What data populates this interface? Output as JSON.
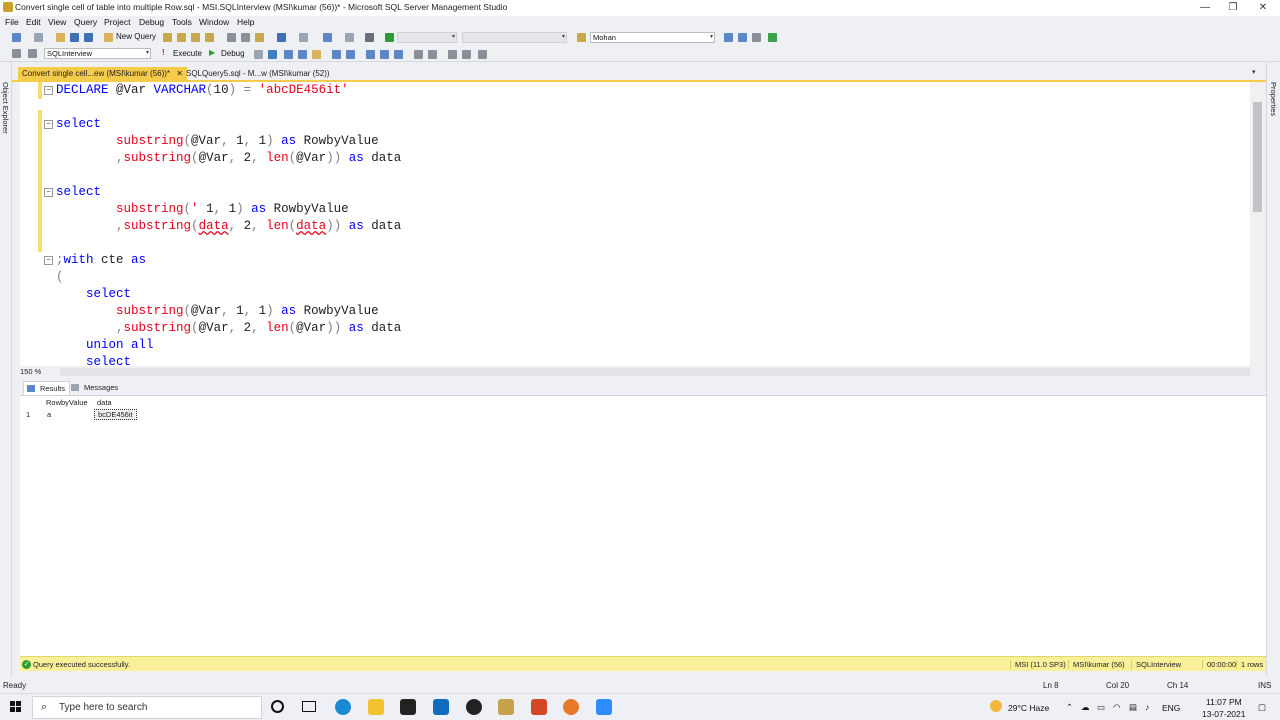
{
  "window": {
    "title": "Convert single cell of table into multiple Row.sql - MSI.SQLInterview (MSI\\kumar (56))* - Microsoft SQL Server Management Studio",
    "min": "—",
    "max": "❐",
    "close": "✕"
  },
  "menu": [
    "File",
    "Edit",
    "View",
    "Query",
    "Project",
    "Debug",
    "Tools",
    "Window",
    "Help"
  ],
  "toolbar": {
    "new_query": "New Query",
    "search_combo": "Mohan",
    "database_combo": "SQLInterview",
    "execute": "Execute",
    "debug": "Debug"
  },
  "side_panels": {
    "left": "Object Explorer",
    "right": "Properties"
  },
  "tabs": [
    {
      "label": "Convert single cell...ew (MSI\\kumar (56))*",
      "close": "✕",
      "active": true
    },
    {
      "label": "SQLQuery5.sql - M...w (MSI\\kumar (52))",
      "active": false
    }
  ],
  "code_lines": [
    [
      [
        "kw",
        "DECLARE"
      ],
      [
        "cm",
        " @Var "
      ],
      [
        "kw",
        "VARCHAR"
      ],
      [
        "op",
        "("
      ],
      [
        "cm",
        "10"
      ],
      [
        "op",
        ")"
      ],
      [
        "cm",
        " "
      ],
      [
        "op",
        "="
      ],
      [
        "cm",
        " "
      ],
      [
        "str",
        "'abcDE456it'"
      ]
    ],
    [],
    [
      [
        "kw",
        "select"
      ]
    ],
    [
      [
        "cm",
        "        "
      ],
      [
        "fn",
        "substring"
      ],
      [
        "op",
        "("
      ],
      [
        "cm",
        "@Var"
      ],
      [
        "op",
        ","
      ],
      [
        "cm",
        " 1"
      ],
      [
        "op",
        ","
      ],
      [
        "cm",
        " 1"
      ],
      [
        "op",
        ")"
      ],
      [
        "cm",
        " "
      ],
      [
        "kw",
        "as"
      ],
      [
        "cm",
        " RowbyValue"
      ]
    ],
    [
      [
        "cm",
        "        "
      ],
      [
        "op",
        ","
      ],
      [
        "fn",
        "substring"
      ],
      [
        "op",
        "("
      ],
      [
        "cm",
        "@Var"
      ],
      [
        "op",
        ","
      ],
      [
        "cm",
        " 2"
      ],
      [
        "op",
        ","
      ],
      [
        "cm",
        " "
      ],
      [
        "fn",
        "len"
      ],
      [
        "op",
        "("
      ],
      [
        "cm",
        "@Var"
      ],
      [
        "op",
        "))"
      ],
      [
        "cm",
        " "
      ],
      [
        "kw",
        "as"
      ],
      [
        "cm",
        " data"
      ]
    ],
    [],
    [
      [
        "kw",
        "select"
      ]
    ],
    [
      [
        "cm",
        "        "
      ],
      [
        "fn",
        "substring"
      ],
      [
        "op",
        "("
      ],
      [
        "str",
        "'"
      ],
      [
        "cm",
        " 1"
      ],
      [
        "op",
        ","
      ],
      [
        "cm",
        " 1"
      ],
      [
        "op",
        ")"
      ],
      [
        "cm",
        " "
      ],
      [
        "kw",
        "as"
      ],
      [
        "cm",
        " RowbyValue"
      ]
    ],
    [
      [
        "cm",
        "        "
      ],
      [
        "op",
        ","
      ],
      [
        "fn",
        "substring"
      ],
      [
        "op",
        "("
      ],
      [
        "sq",
        "data"
      ],
      [
        "op",
        ","
      ],
      [
        "cm",
        " 2"
      ],
      [
        "op",
        ","
      ],
      [
        "cm",
        " "
      ],
      [
        "fn",
        "len"
      ],
      [
        "op",
        "("
      ],
      [
        "sq",
        "data"
      ],
      [
        "op",
        "))"
      ],
      [
        "cm",
        " "
      ],
      [
        "kw",
        "as"
      ],
      [
        "cm",
        " data"
      ]
    ],
    [],
    [
      [
        "op",
        ";"
      ],
      [
        "kw",
        "with"
      ],
      [
        "cm",
        " cte "
      ],
      [
        "kw",
        "as"
      ]
    ],
    [
      [
        "op",
        "("
      ]
    ],
    [
      [
        "cm",
        "    "
      ],
      [
        "kw",
        "select"
      ]
    ],
    [
      [
        "cm",
        "        "
      ],
      [
        "fn",
        "substring"
      ],
      [
        "op",
        "("
      ],
      [
        "cm",
        "@Var"
      ],
      [
        "op",
        ","
      ],
      [
        "cm",
        " 1"
      ],
      [
        "op",
        ","
      ],
      [
        "cm",
        " 1"
      ],
      [
        "op",
        ")"
      ],
      [
        "cm",
        " "
      ],
      [
        "kw",
        "as"
      ],
      [
        "cm",
        " RowbyValue"
      ]
    ],
    [
      [
        "cm",
        "        "
      ],
      [
        "op",
        ","
      ],
      [
        "fn",
        "substring"
      ],
      [
        "op",
        "("
      ],
      [
        "cm",
        "@Var"
      ],
      [
        "op",
        ","
      ],
      [
        "cm",
        " 2"
      ],
      [
        "op",
        ","
      ],
      [
        "cm",
        " "
      ],
      [
        "fn",
        "len"
      ],
      [
        "op",
        "("
      ],
      [
        "cm",
        "@Var"
      ],
      [
        "op",
        "))"
      ],
      [
        "cm",
        " "
      ],
      [
        "kw",
        "as"
      ],
      [
        "cm",
        " data"
      ]
    ],
    [
      [
        "cm",
        "    "
      ],
      [
        "kw",
        "union all"
      ]
    ],
    [
      [
        "cm",
        "    "
      ],
      [
        "kw",
        "select"
      ]
    ]
  ],
  "zoom": "150 %",
  "result_tabs": [
    "Results",
    "Messages"
  ],
  "results": {
    "columns": [
      "RowbyValue",
      "data"
    ],
    "rows": [
      {
        "num": "1",
        "cells": [
          "a",
          "bcDE456it"
        ]
      }
    ]
  },
  "status": {
    "message": "Query executed successfully.",
    "server": "MSI (11.0 SP3)",
    "user": "MSI\\kumar (56)",
    "database": "SQLInterview",
    "time": "00:00:00",
    "rows": "1 rows"
  },
  "ready": {
    "state": "Ready",
    "ln": "Ln 8",
    "col": "Col 20",
    "ch": "Ch 14",
    "mode": "INS"
  },
  "taskbar": {
    "search_placeholder": "Type here to search",
    "weather": "29°C  Haze",
    "lang": "ENG",
    "time": "11:07 PM",
    "date": "13-07-2021"
  }
}
